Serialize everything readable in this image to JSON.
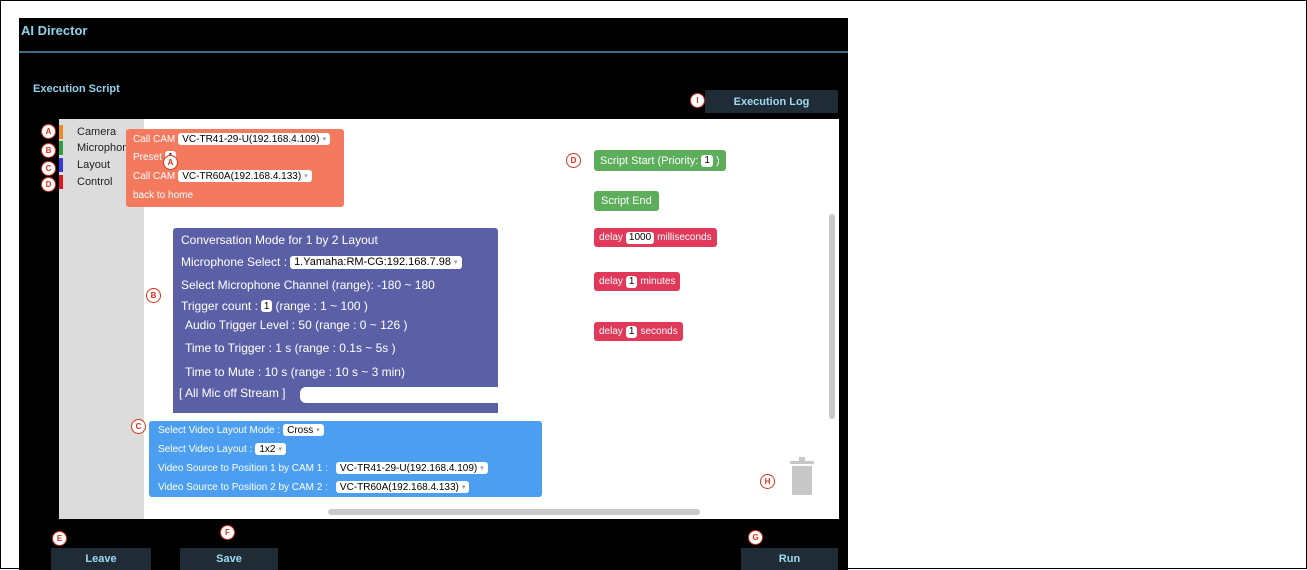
{
  "app": {
    "title": "AI Director"
  },
  "section_title": "Execution Script",
  "buttons": {
    "execution_log": "Execution Log",
    "leave": "Leave",
    "save": "Save",
    "run": "Run"
  },
  "toolbox": [
    {
      "label": "Camera",
      "color": "#f08a24"
    },
    {
      "label": "Microphone",
      "color": "#2f9e44"
    },
    {
      "label": "Layout",
      "color": "#3b3bdd"
    },
    {
      "label": "Control",
      "color": "#e0161e"
    }
  ],
  "camera_block": {
    "call_cam_label": "Call CAM",
    "cam1": "VC-TR41-29-U(192.168.4.109)",
    "preset_label": "Preset",
    "preset_value": "1",
    "cam2": "VC-TR60A(192.168.4.133)",
    "back_home": "back to home"
  },
  "mic_block": {
    "title": "Conversation Mode for 1 by 2 Layout",
    "mic_select_label": "Microphone Select :",
    "mic_select_value": "1.Yamaha:RM-CG:192.168.7.98",
    "channel_label": "Select Microphone Channel (range):  -180  ~  180",
    "trigger_count_label": "Trigger count :",
    "trigger_count_value": "1",
    "trigger_count_range": "(range :  1  ~  100  )",
    "audio_level": "Audio Trigger Level :  50   (range :  0  ~  126   )",
    "time_trigger": "Time to Trigger :   1  s   (range :  0.1s  ~  5s   )",
    "time_mute": "Time to Mute :  10  s   (range :  10 s  ~  3   min)",
    "stream": "[ All Mic off Stream ]"
  },
  "layout_block": {
    "mode_label": "Select Video Layout Mode :",
    "mode_value": "Cross",
    "layout_label": "Select Video Layout :",
    "layout_value": "1x2",
    "pos1_label": "Video Source to Position  1  by CAM 1 :",
    "pos1_value": "VC-TR41-29-U(192.168.4.109)",
    "pos2_label": "Video Source to Position  2  by CAM 2 :",
    "pos2_value": "VC-TR60A(192.168.4.133)"
  },
  "control_blocks": {
    "script_start_label": "Script Start (Priority:",
    "script_start_value": "1",
    "script_start_close": ")",
    "script_end": "Script End",
    "delay_label": "delay",
    "delay_ms_value": "1000",
    "delay_ms_unit": "milliseconds",
    "delay_min_value": "1",
    "delay_min_unit": "minutes",
    "delay_sec_value": "1",
    "delay_sec_unit": "seconds"
  },
  "markers": [
    "A",
    "B",
    "C",
    "D",
    "A",
    "B",
    "C",
    "D",
    "E",
    "F",
    "G",
    "H",
    "I"
  ]
}
